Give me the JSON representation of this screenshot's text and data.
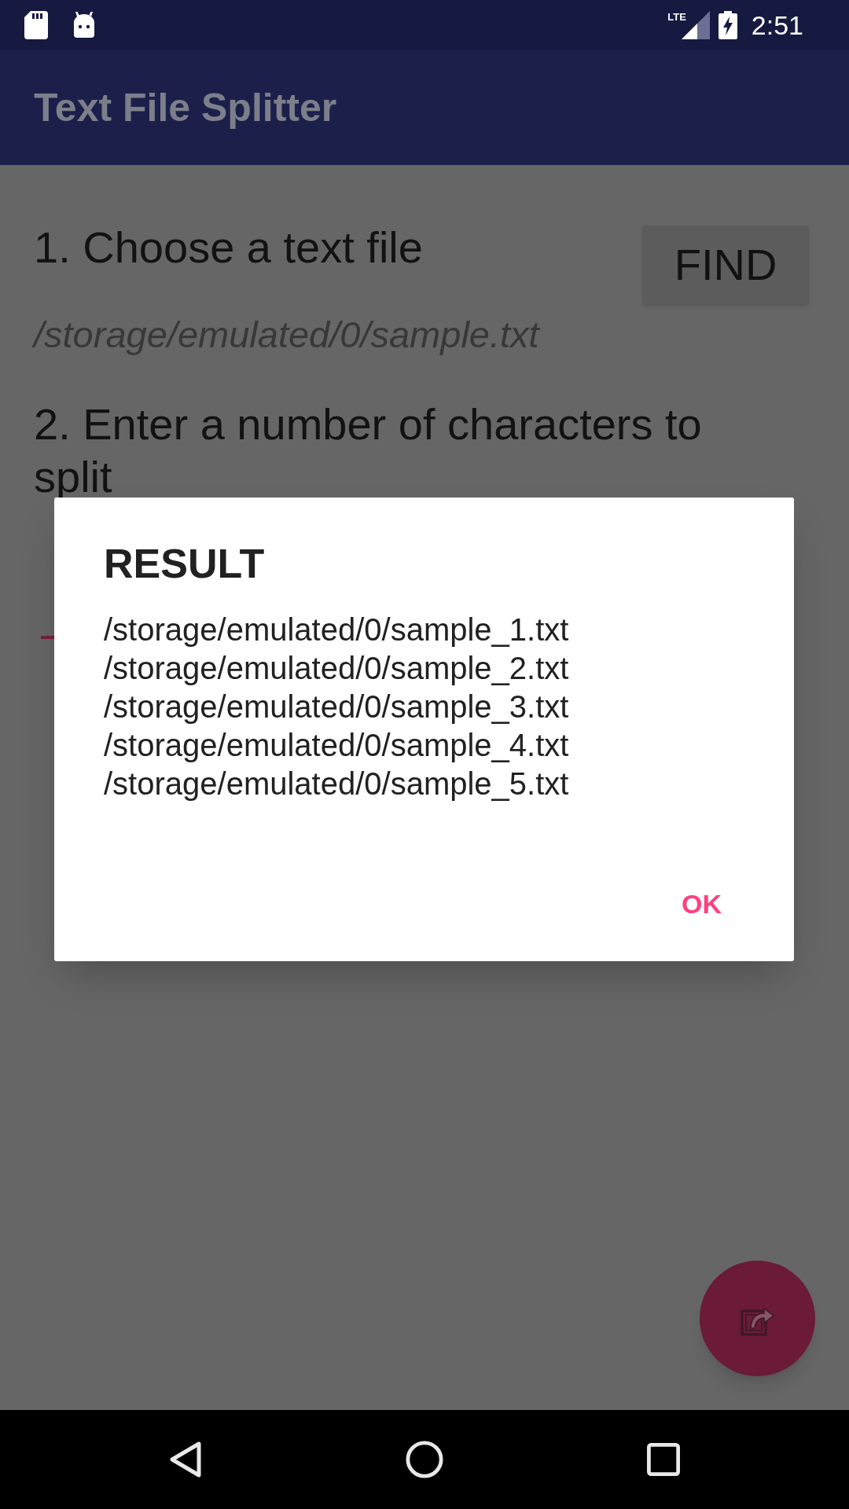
{
  "status_bar": {
    "network_type": "LTE",
    "time": "2:51"
  },
  "app_bar": {
    "title": "Text File Splitter"
  },
  "step_1": {
    "label": "1. Choose a text file",
    "button": "FIND",
    "selected_file": "/storage/emulated/0/sample.txt"
  },
  "step_2": {
    "label": "2. Enter a number of characters to split"
  },
  "dialog": {
    "title": "RESULT",
    "lines": [
      "/storage/emulated/0/sample_1.txt",
      "/storage/emulated/0/sample_2.txt",
      "/storage/emulated/0/sample_3.txt",
      "/storage/emulated/0/sample_4.txt",
      "/storage/emulated/0/sample_5.txt"
    ],
    "button": "OK"
  }
}
